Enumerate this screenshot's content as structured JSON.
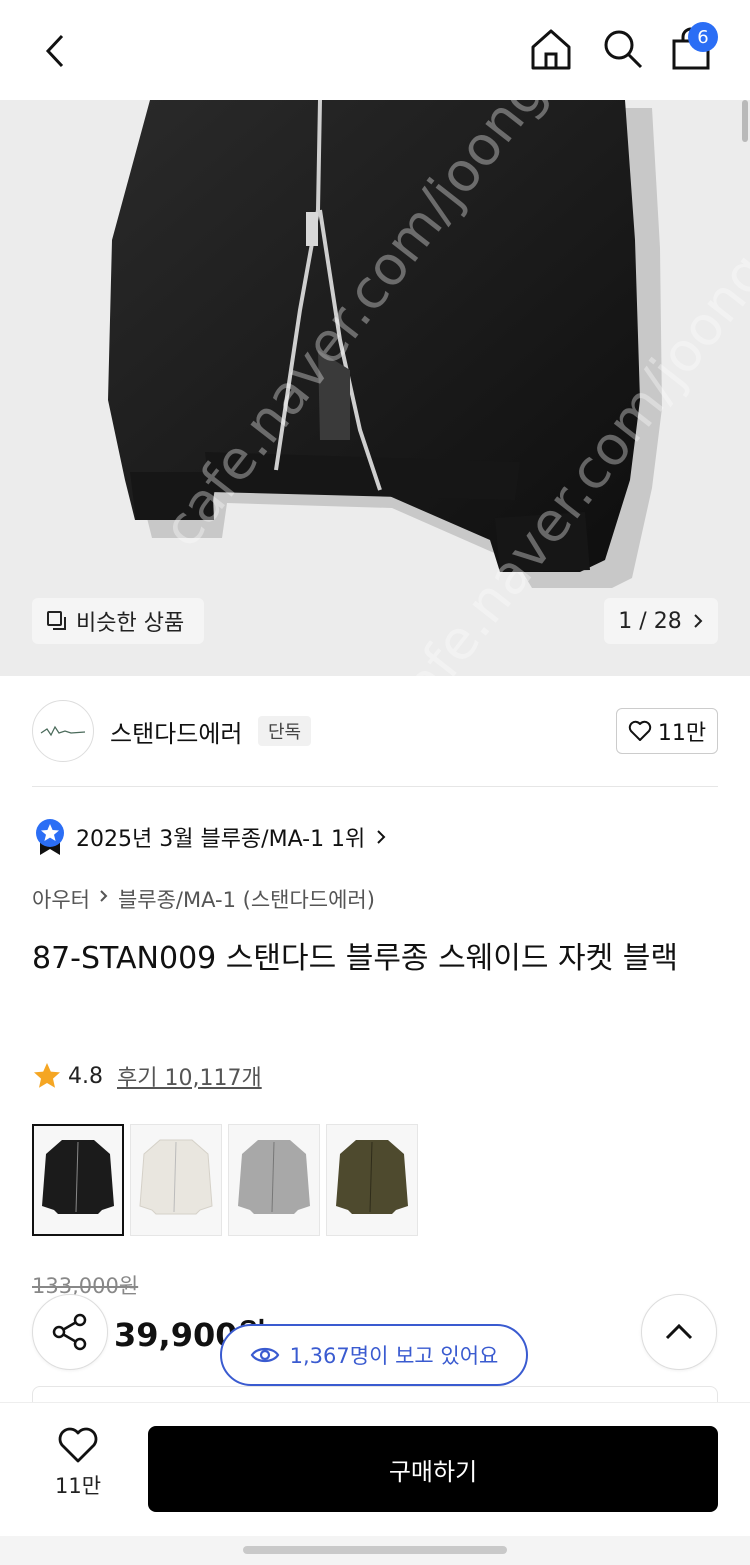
{
  "header": {
    "cart_count": "6"
  },
  "hero": {
    "similar_label": "비슷한 상품",
    "pager_label": "1 / 28",
    "watermark": "cafe.naver.com/joonggonara"
  },
  "brand": {
    "name": "스탠다드에러",
    "tag": "단독",
    "likes": "11만"
  },
  "ranking": {
    "text": "2025년 3월 블루종/MA-1 1위"
  },
  "breadcrumb": {
    "category": "아우터",
    "subcategory": "블루종/MA-1 (스탠다드에러)"
  },
  "product": {
    "title": "87-STAN009 스탠다드 블루종 스웨이드 자켓 블랙",
    "rating": "4.8",
    "reviews": "후기 10,117개",
    "original_price": "133,000원",
    "sale_price": "39,900원"
  },
  "swatches": [
    {
      "color": "#1b1b1b"
    },
    {
      "color": "#e9e6df"
    },
    {
      "color": "#a8a8a8"
    },
    {
      "color": "#4e4a2e"
    }
  ],
  "viewers": {
    "text": "1,367명이 보고 있어요"
  },
  "bottom": {
    "wish_count": "11만",
    "buy_label": "구매하기"
  },
  "colors": {
    "accent_blue": "#3a5bd0",
    "badge_blue": "#2b6ef5",
    "star": "#f5a623"
  }
}
